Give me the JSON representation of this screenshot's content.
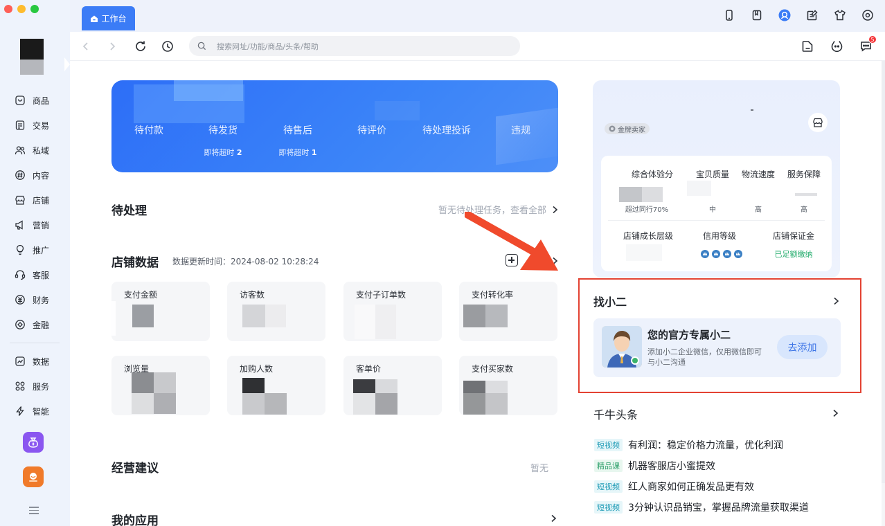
{
  "topbar": {
    "tab_label": "工作台",
    "search_placeholder": "搜索网址/功能/商品/头条/帮助",
    "message_badge": "5"
  },
  "sidebar": {
    "items": [
      {
        "label": "商品",
        "icon": "product-icon"
      },
      {
        "label": "交易",
        "icon": "trade-icon"
      },
      {
        "label": "私域",
        "icon": "private-domain-icon"
      },
      {
        "label": "内容",
        "icon": "content-icon"
      },
      {
        "label": "店铺",
        "icon": "store-icon"
      },
      {
        "label": "营销",
        "icon": "marketing-icon"
      },
      {
        "label": "推广",
        "icon": "promotion-icon"
      },
      {
        "label": "客服",
        "icon": "customer-service-icon"
      },
      {
        "label": "财务",
        "icon": "finance-icon"
      },
      {
        "label": "金融",
        "icon": "banking-icon"
      }
    ],
    "items2": [
      {
        "label": "数据",
        "icon": "data-icon"
      },
      {
        "label": "服务",
        "icon": "service-icon"
      },
      {
        "label": "智能",
        "icon": "smart-icon"
      }
    ]
  },
  "orders": {
    "items": [
      {
        "label": "待付款"
      },
      {
        "label": "待发货",
        "sub": "即将超时",
        "count": "2"
      },
      {
        "label": "待售后",
        "sub": "即将超时",
        "count": "1"
      },
      {
        "label": "待评价"
      },
      {
        "label": "待处理投诉"
      },
      {
        "label": "违规"
      }
    ]
  },
  "todo": {
    "title": "待处理",
    "right": "暂无待处理任务，查看全部"
  },
  "store_data": {
    "title": "店铺数据",
    "update_time": "数据更新时间：2024-08-02 10:28:24",
    "cards": [
      "支付金额",
      "访客数",
      "支付子订单数",
      "支付转化率",
      "浏览量",
      "加购人数",
      "客单价",
      "支付买家数"
    ]
  },
  "advice": {
    "title": "经营建议",
    "right": "暂无"
  },
  "my_apps": {
    "title": "我的应用"
  },
  "shop": {
    "badge": "金牌卖家",
    "metrics_row1": [
      {
        "label": "综合体验分",
        "value": "超过同行70%"
      },
      {
        "label": "宝贝质量",
        "value": "中"
      },
      {
        "label": "物流速度",
        "value": "高"
      },
      {
        "label": "服务保障",
        "value": "高"
      }
    ],
    "metrics_row2": [
      {
        "label": "店铺成长层级",
        "value": ""
      },
      {
        "label": "信用等级",
        "value": ""
      },
      {
        "label": "店铺保证金",
        "value": "已足额缴纳"
      }
    ]
  },
  "xiaoer": {
    "title": "找小二",
    "headline": "您的官方专属小二",
    "desc": "添加小二企业微信，仅用微信即可与小二沟通",
    "button": "去添加"
  },
  "headlines": {
    "title": "千牛头条",
    "items": [
      {
        "tag": "短视频",
        "text": "有利润：稳定价格力流量，优化利润"
      },
      {
        "tag": "精品课",
        "text": "机器客服店小蜜提效"
      },
      {
        "tag": "短视频",
        "text": "红人商家如何正确发品更有效"
      },
      {
        "tag": "短视频",
        "text": "3分钟认识品销宝，掌握品牌流量获取渠道"
      }
    ]
  },
  "colors": {
    "accent": "#3b7cf6",
    "highlight": "#e34232",
    "badge": "#f5363a"
  }
}
